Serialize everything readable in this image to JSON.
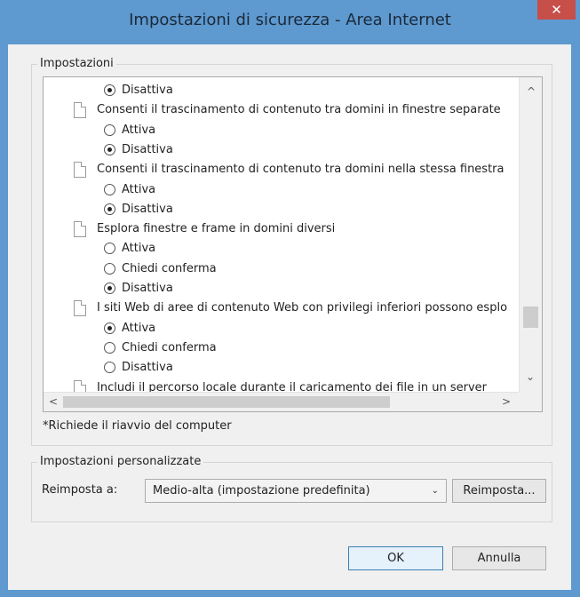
{
  "window": {
    "title": "Impostazioni di sicurezza - Area Internet",
    "close_symbol": "✕"
  },
  "settings_group": {
    "label": "Impostazioni",
    "rows": [
      {
        "kind": "option",
        "text": "Disattiva",
        "checked": true
      },
      {
        "kind": "setting",
        "text": "Consenti il trascinamento di contenuto tra domini in finestre separate"
      },
      {
        "kind": "option",
        "text": "Attiva",
        "checked": false
      },
      {
        "kind": "option",
        "text": "Disattiva",
        "checked": true
      },
      {
        "kind": "setting",
        "text": "Consenti il trascinamento di contenuto tra domini nella stessa finestra"
      },
      {
        "kind": "option",
        "text": "Attiva",
        "checked": false
      },
      {
        "kind": "option",
        "text": "Disattiva",
        "checked": true
      },
      {
        "kind": "setting",
        "text": "Esplora finestre e frame in domini diversi"
      },
      {
        "kind": "option",
        "text": "Attiva",
        "checked": false
      },
      {
        "kind": "option",
        "text": "Chiedi conferma",
        "checked": false
      },
      {
        "kind": "option",
        "text": "Disattiva",
        "checked": true
      },
      {
        "kind": "setting",
        "text": "I siti Web di aree di contenuto Web con privilegi inferiori possono esplo"
      },
      {
        "kind": "option",
        "text": "Attiva",
        "checked": true
      },
      {
        "kind": "option",
        "text": "Chiedi conferma",
        "checked": false
      },
      {
        "kind": "option",
        "text": "Disattiva",
        "checked": false
      },
      {
        "kind": "setting",
        "text": "Includi il percorso locale durante il caricamento dei file in un server"
      }
    ],
    "restart_note": "*Richiede il riavvio del computer"
  },
  "custom_group": {
    "label": "Impostazioni personalizzate",
    "reset_label": "Reimposta a:",
    "reset_value": "Medio-alta (impostazione predefinita)",
    "reset_button": "Reimposta..."
  },
  "footer": {
    "ok": "OK",
    "cancel": "Annulla"
  },
  "icons": {
    "up": "^",
    "down": "⌄",
    "left": "<",
    "right": ">",
    "dropdown": "⌄"
  },
  "colors": {
    "frame": "#5e99cf",
    "close": "#c74f4a",
    "default_button_border": "#3c7fb1"
  }
}
